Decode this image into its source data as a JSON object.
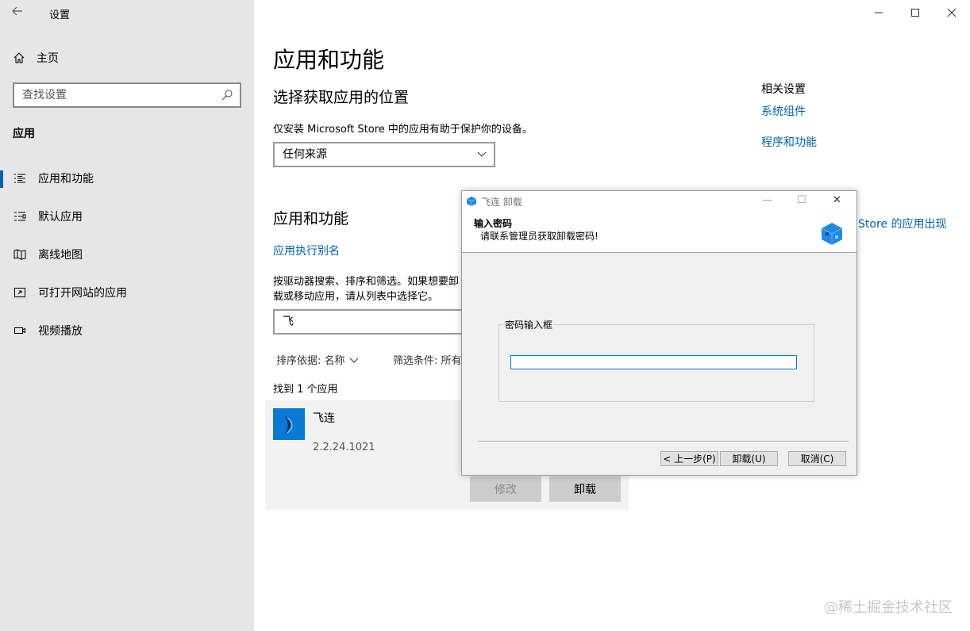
{
  "window": {
    "title": "设置"
  },
  "sidebar": {
    "home_label": "主页",
    "search_placeholder": "查找设置",
    "section_label": "应用",
    "items": [
      {
        "label": "应用和功能",
        "icon": "list-icon"
      },
      {
        "label": "默认应用",
        "icon": "default-apps-icon"
      },
      {
        "label": "离线地图",
        "icon": "map-icon"
      },
      {
        "label": "可打开网站的应用",
        "icon": "open-link-icon"
      },
      {
        "label": "视频播放",
        "icon": "video-icon"
      }
    ]
  },
  "main": {
    "title": "应用和功能",
    "source_heading": "选择获取应用的位置",
    "source_desc": "仅安装 Microsoft Store 中的应用有助于保护你的设备。",
    "source_value": "任何来源",
    "apps_heading": "应用和功能",
    "alias_link": "应用执行别名",
    "search_desc": "按驱动器搜索、排序和筛选。如果想要卸载或移动应用，请从列表中选择它。",
    "search_value": "飞",
    "sort_label": "排序依据: 名称",
    "filter_label": "筛选条件: 所有",
    "found_text": "找到 1 个应用",
    "app": {
      "name": "飞连",
      "version": "2.2.24.1021",
      "modify_label": "修改",
      "uninstall_label": "卸载"
    }
  },
  "related": {
    "heading": "相关设置",
    "link1": "系统组件",
    "link2": "程序和功能",
    "help_link": "Store 的应用出现"
  },
  "dialog": {
    "title": "飞连 卸载",
    "header_title": "输入密码",
    "header_sub": "请联系管理员获取卸载密码!",
    "group_label": "密码输入框",
    "back_btn": "< 上一步(P)",
    "uninstall_btn": "卸载(U)",
    "cancel_btn": "取消(C)"
  },
  "watermark": "@稀土掘金技术社区",
  "colors": {
    "accent": "#0063b1",
    "sidebar_bg": "#e6e6e6"
  }
}
